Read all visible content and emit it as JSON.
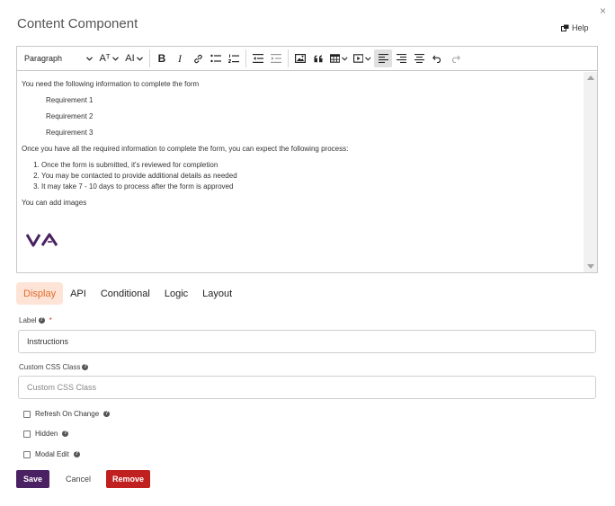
{
  "dialog": {
    "title": "Content Component",
    "help_label": "Help",
    "close_glyph": "×"
  },
  "toolbar": {
    "paragraph_label": "Paragraph",
    "font_size_label": "Aᵀ",
    "font_case_label": "AI",
    "bold_label": "B",
    "italic_label": "I"
  },
  "editor": {
    "intro": "You need the following information to complete the form",
    "requirements": [
      "Requirement 1",
      "Requirement 2",
      "Requirement 3"
    ],
    "process_intro": "Once you have all the required information to complete the form, you can expect the following process:",
    "steps": [
      "Once the form is submitted, it's reviewed for completion",
      "You may be contacted to provide additional details as needed",
      "It may take 7 - 10 days to process after the form is approved"
    ],
    "images_text": "You can add images",
    "logo_color": "#4a2163"
  },
  "tabs": [
    {
      "label": "Display",
      "active": true
    },
    {
      "label": "API",
      "active": false
    },
    {
      "label": "Conditional",
      "active": false
    },
    {
      "label": "Logic",
      "active": false
    },
    {
      "label": "Layout",
      "active": false
    }
  ],
  "form": {
    "label_field": {
      "label": "Label",
      "required_mark": "*",
      "value": "Instructions"
    },
    "css_field": {
      "label": "Custom CSS Class",
      "placeholder": "Custom CSS Class"
    },
    "checkboxes": [
      {
        "label": "Refresh On Change",
        "checked": false
      },
      {
        "label": "Hidden",
        "checked": false
      },
      {
        "label": "Modal Edit",
        "checked": false
      }
    ]
  },
  "buttons": {
    "save": "Save",
    "cancel": "Cancel",
    "remove": "Remove"
  },
  "colors": {
    "accent_tab_bg": "#fde4d6",
    "accent_tab_text": "#e06b2f",
    "save_bg": "#4a2163",
    "remove_bg": "#c0201f",
    "required": "#d32f2f"
  }
}
